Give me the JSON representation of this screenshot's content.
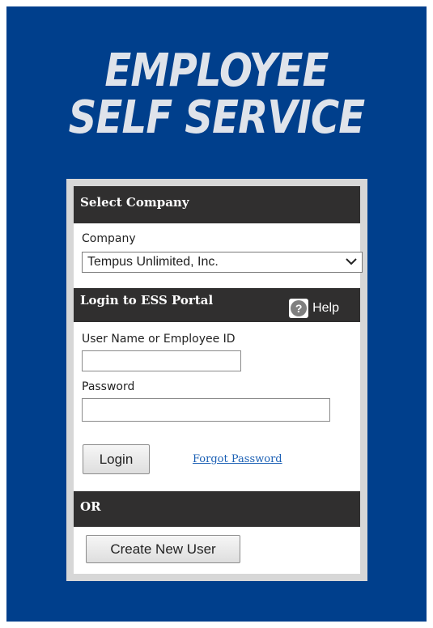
{
  "banner": {
    "title_line1": "EMPLOYEE",
    "title_line2": "SELF SERVICE"
  },
  "select_company": {
    "header": "Select Company",
    "company_label": "Company",
    "company_value": "Tempus Unlimited, Inc."
  },
  "login": {
    "header": "Login to ESS Portal",
    "help_label": "Help",
    "help_icon": "question-mark-icon",
    "username_label": "User Name or Employee ID",
    "username_value": "",
    "password_label": "Password",
    "password_value": "",
    "login_button": "Login",
    "forgot_password": "Forgot Password"
  },
  "alternate": {
    "header": "OR",
    "create_button": "Create New User"
  },
  "colors": {
    "panel_blue": "#003f8c",
    "header_dark": "#302f2f",
    "title_text": "#dfe3ea",
    "link_blue": "#1a5fb4"
  }
}
